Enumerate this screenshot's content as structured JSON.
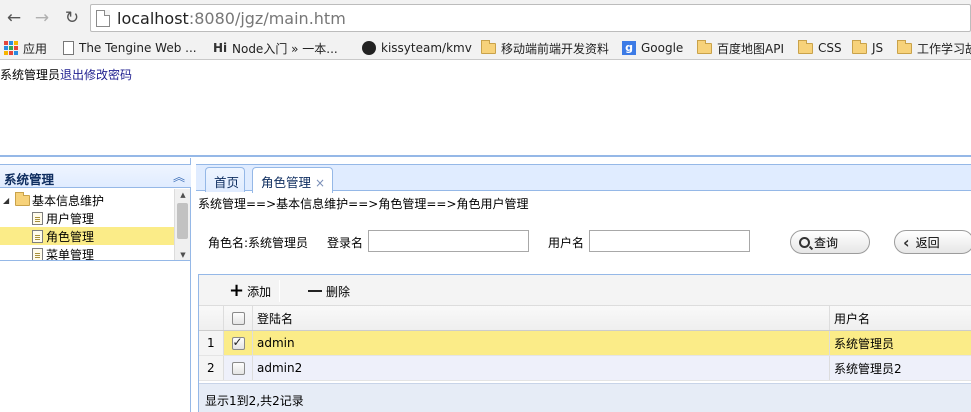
{
  "browser": {
    "url_host": "localhost",
    "url_path": ":8080/jgz/main.htm",
    "bookmarks": [
      {
        "label": "应用",
        "icon": "apps-icon"
      },
      {
        "label": "The Tengine Web ...",
        "icon": "page-icon"
      },
      {
        "label": "Node入门 » 一本...",
        "icon": "hi-icon"
      },
      {
        "label": "kissyteam/kmv",
        "icon": "github-icon"
      },
      {
        "label": "移动端前端开发资料",
        "icon": "folder-icon"
      },
      {
        "label": "Google",
        "icon": "google-icon"
      },
      {
        "label": "百度地图API",
        "icon": "folder-icon"
      },
      {
        "label": "CSS",
        "icon": "folder-icon"
      },
      {
        "label": "JS",
        "icon": "folder-icon"
      },
      {
        "label": "工作学习故",
        "icon": "folder-icon"
      }
    ]
  },
  "header": {
    "user": "系统管理员",
    "logout": "退出",
    "change_password": "修改密码"
  },
  "west": {
    "title": "系统管理",
    "tree": {
      "root": "基本信息维护",
      "items": [
        "用户管理",
        "角色管理",
        "菜单管理"
      ],
      "selected_index": 1
    }
  },
  "tabs": [
    {
      "label": "首页"
    },
    {
      "label": "角色管理",
      "closable": true
    }
  ],
  "breadcrumb": "系统管理==>基本信息维护==>角色管理==>角色用户管理",
  "search": {
    "role_label": "角色名:系统管理员",
    "login_label": "登录名",
    "login_value": "",
    "user_label": "用户名",
    "user_value": "",
    "query_button": "查询",
    "back_button": "返回"
  },
  "grid": {
    "toolbar": {
      "add": "添加",
      "delete": "删除"
    },
    "columns": {
      "login": "登陆名",
      "username": "用户名"
    },
    "rows": [
      {
        "num": "1",
        "checked": true,
        "login": "admin",
        "username": "系统管理员"
      },
      {
        "num": "2",
        "checked": false,
        "login": "admin2",
        "username": "系统管理员2"
      }
    ],
    "pager": "显示1到2,共2记录"
  },
  "colors": {
    "accent_border": "#95b8e7",
    "selected_row": "#fbec88",
    "alt_row": "#eef0fa"
  }
}
